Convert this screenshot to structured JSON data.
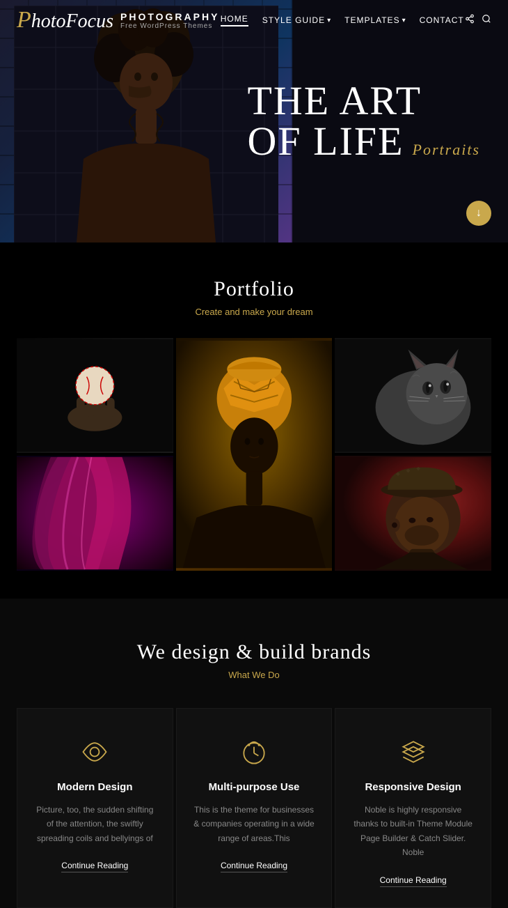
{
  "header": {
    "logo_letter": "P",
    "logo_name": "hotoFocus",
    "logo_title": "PHOTOGRAPHY",
    "logo_subtitle": "Free WordPress Themes",
    "nav": {
      "items": [
        {
          "label": "HOME",
          "active": true,
          "has_dropdown": false
        },
        {
          "label": "STYLE GUIDE",
          "active": false,
          "has_dropdown": true
        },
        {
          "label": "TEMPLATES",
          "active": false,
          "has_dropdown": true
        },
        {
          "label": "COntACT",
          "active": false,
          "has_dropdown": false
        }
      ],
      "social_icon": "share-icon",
      "search_icon": "search-icon"
    }
  },
  "hero": {
    "line1": "THE ART",
    "line2": "OF LIFE",
    "tag": "Portraits",
    "scroll_icon": "↓"
  },
  "portfolio": {
    "title": "Portfolio",
    "subtitle": "Create and make your dream",
    "images": [
      {
        "id": "baseball",
        "alt": "Hand holding baseball",
        "style": "baseball"
      },
      {
        "id": "portrait-tall",
        "alt": "African woman portrait",
        "style": "portrait-tall"
      },
      {
        "id": "cat",
        "alt": "Cat looking up",
        "style": "cat"
      },
      {
        "id": "purple-hair",
        "alt": "Purple hair",
        "style": "purple-hair"
      },
      {
        "id": "man-hat",
        "alt": "Man with hat",
        "style": "man-hat"
      }
    ]
  },
  "services": {
    "title": "We design & build brands",
    "subtitle": "What We Do",
    "cards": [
      {
        "icon": "eye-icon",
        "title": "Modern Design",
        "desc": "Picture, too, the sudden shifting of the attention, the swiftly spreading coils and bellyings of",
        "link": "Continue Reading"
      },
      {
        "icon": "clock-icon",
        "title": "Multi-purpose Use",
        "desc": "This is the theme for businesses & companies operating in a wide range of areas.This",
        "link": "Continue Reading"
      },
      {
        "icon": "layers-icon",
        "title": "Responsive Design",
        "desc": "Noble is highly responsive thanks to built-in Theme Module Page Builder & Catch Slider. Noble",
        "link": "Continue Reading"
      }
    ]
  }
}
